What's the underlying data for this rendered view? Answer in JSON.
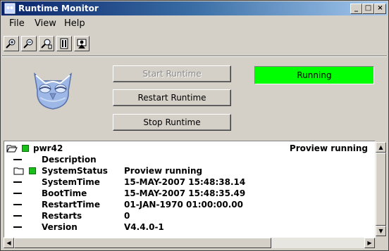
{
  "window": {
    "title": "Runtime Monitor"
  },
  "menu": {
    "file": "File",
    "view": "View",
    "help": "Help"
  },
  "toolbar": {
    "icons": [
      "zoom-in-icon",
      "zoom-out-icon",
      "zoom-reset-icon",
      "open-graph-icon",
      "object-display-icon"
    ]
  },
  "controls": {
    "start_runtime": "Start Runtime",
    "restart_runtime": "Restart Runtime",
    "stop_runtime": "Stop Runtime",
    "status": "Running",
    "status_color": "#00ff00"
  },
  "tree": {
    "root": {
      "name": "pwr42",
      "status": "Proview running"
    },
    "items": [
      {
        "name": "Description",
        "value": ""
      },
      {
        "name": "SystemStatus",
        "value": "Proview running"
      },
      {
        "name": "SystemTime",
        "value": "15-MAY-2007 15:48:38.14"
      },
      {
        "name": "BootTime",
        "value": "15-MAY-2007 15:48:35.49"
      },
      {
        "name": "RestartTime",
        "value": "01-JAN-1970 01:00:00.00"
      },
      {
        "name": "Restarts",
        "value": "0"
      },
      {
        "name": "Version",
        "value": "V4.4.0-1"
      }
    ]
  }
}
